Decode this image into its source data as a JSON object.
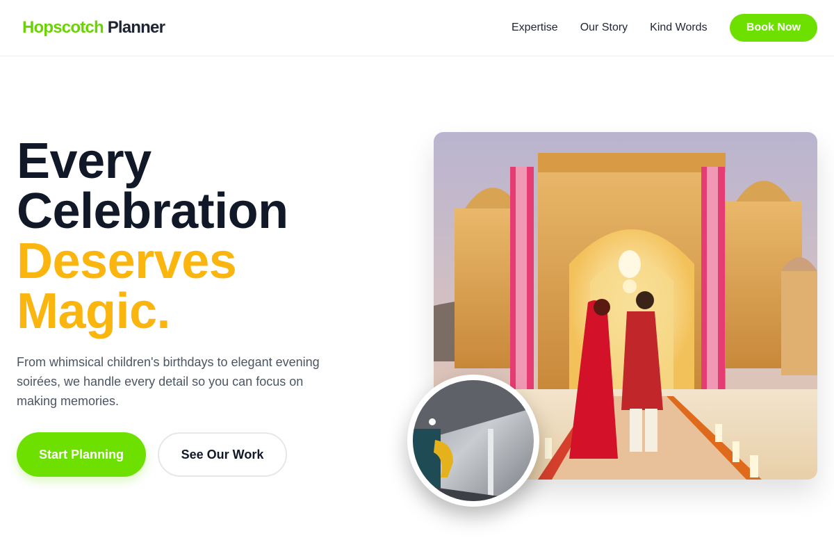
{
  "header": {
    "logo_part1": "Hopscotch",
    "logo_part2": "Planner",
    "nav": [
      {
        "label": "Expertise"
      },
      {
        "label": "Our Story"
      },
      {
        "label": "Kind Words"
      }
    ],
    "cta_label": "Book Now"
  },
  "hero": {
    "headline_line1": "Every",
    "headline_line2": "Celebration",
    "headline_line3": "Deserves",
    "headline_line4": "Magic.",
    "lead": "From whimsical children's birthdays to elegant evening soirées, we handle every detail so you can focus on making memories.",
    "primary_label": "Start Planning",
    "secondary_label": "See Our Work"
  },
  "colors": {
    "accent_green": "#6ee000",
    "accent_gold": "#fbb50f",
    "text_dark": "#111827",
    "text_muted": "#4b5563"
  }
}
